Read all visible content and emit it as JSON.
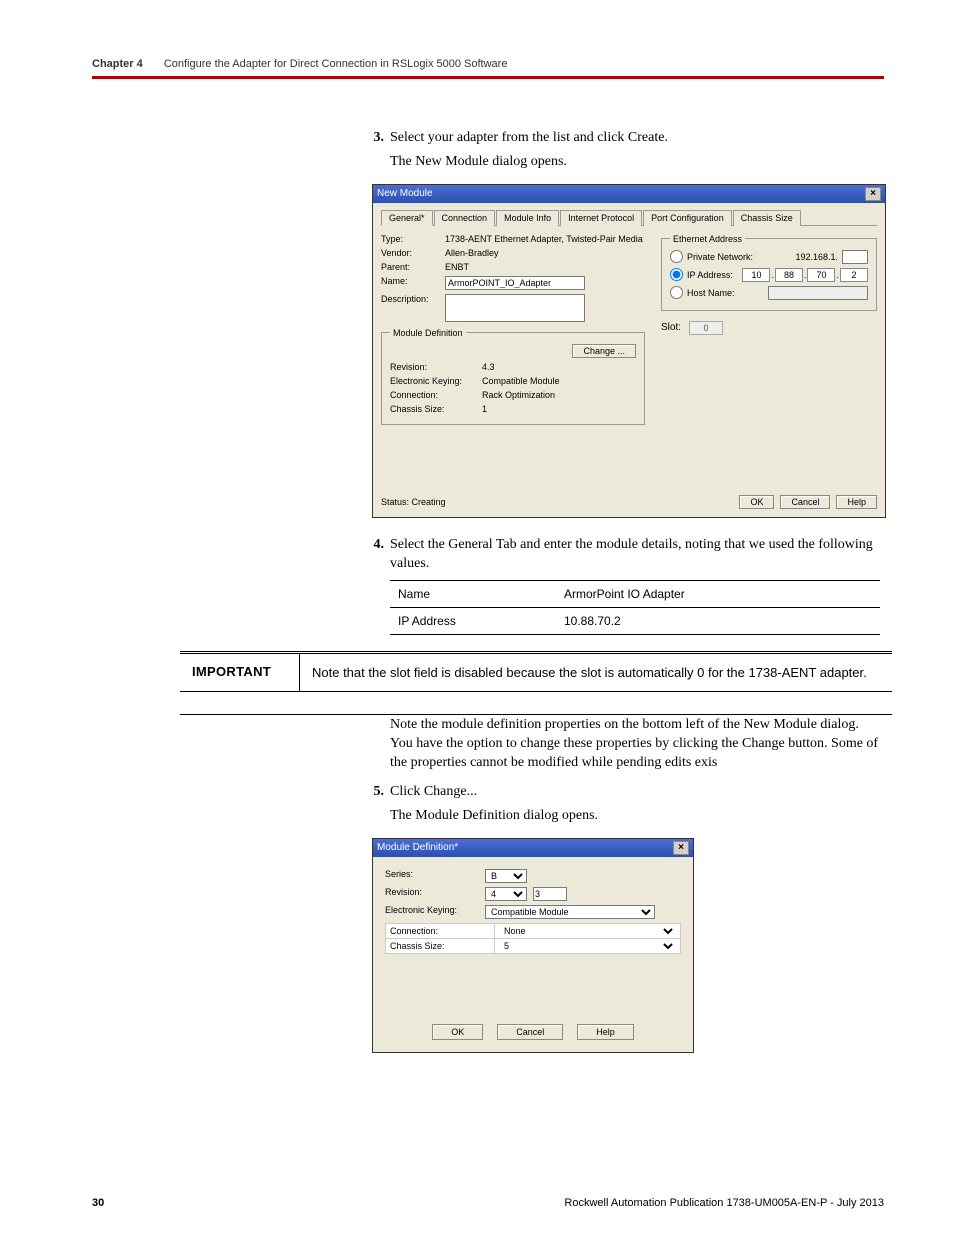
{
  "header": {
    "chapter": "Chapter 4",
    "title": "Configure the Adapter for Direct Connection in RSLogix 5000 Software"
  },
  "steps": {
    "s3": {
      "num": "3.",
      "text": "Select your adapter from the list and click Create.",
      "sub": "The New Module dialog opens."
    },
    "s4": {
      "num": "4.",
      "text": "Select the General Tab and enter the module details, noting that we used the following values."
    },
    "s5": {
      "num": "5.",
      "text": "Click Change...",
      "sub": "The Module Definition dialog opens."
    }
  },
  "dlg1": {
    "title": "New Module",
    "tabs": [
      "General*",
      "Connection",
      "Module Info",
      "Internet Protocol",
      "Port Configuration",
      "Chassis Size"
    ],
    "type_label": "Type:",
    "type_value": "1738-AENT Ethernet Adapter, Twisted-Pair Media",
    "vendor_label": "Vendor:",
    "vendor_value": "Allen-Bradley",
    "parent_label": "Parent:",
    "parent_value": "ENBT",
    "name_label": "Name:",
    "name_value": "ArmorPOINT_IO_Adapter",
    "desc_label": "Description:",
    "desc_value": "",
    "ea_legend": "Ethernet Address",
    "ea_private": "Private Network:",
    "ea_private_val": "192.168.1.",
    "ea_ip": "IP Address:",
    "ea_ip_oct": [
      "10",
      "88",
      "70",
      "2"
    ],
    "ea_host": "Host Name:",
    "slot_label": "Slot:",
    "slot_value": "0",
    "md_legend": "Module Definition",
    "change_btn": "Change ...",
    "rev_label": "Revision:",
    "rev_value": "4.3",
    "ek_label": "Electronic Keying:",
    "ek_value": "Compatible Module",
    "conn_label": "Connection:",
    "conn_value": "Rack Optimization",
    "cs_label": "Chassis Size:",
    "cs_value": "1",
    "status": "Status: Creating",
    "ok": "OK",
    "cancel": "Cancel",
    "help": "Help"
  },
  "details": {
    "name_label": "Name",
    "name_value": "ArmorPoint IO Adapter",
    "ip_label": "IP Address",
    "ip_value": "10.88.70.2"
  },
  "important": {
    "label": "IMPORTANT",
    "text": "Note that the slot field is disabled because the slot is automatically 0 for the 1738-AENT adapter."
  },
  "para1": "Note the module definition properties on the bottom left of the New Module dialog. You have the option to change these properties by clicking the Change button. Some of the properties cannot be modified while pending edits exis",
  "dlg2": {
    "title": "Module Definition*",
    "series_label": "Series:",
    "series_value": "B",
    "rev_label": "Revision:",
    "rev_major": "4",
    "rev_minor": "3",
    "ek_label": "Electronic Keying:",
    "ek_value": "Compatible Module",
    "conn_label": "Connection:",
    "conn_value": "None",
    "cs_label": "Chassis Size:",
    "cs_value": "5",
    "ok": "OK",
    "cancel": "Cancel",
    "help": "Help"
  },
  "footer": {
    "page": "30",
    "pub": "Rockwell Automation Publication 1738-UM005A-EN-P - July 2013"
  }
}
